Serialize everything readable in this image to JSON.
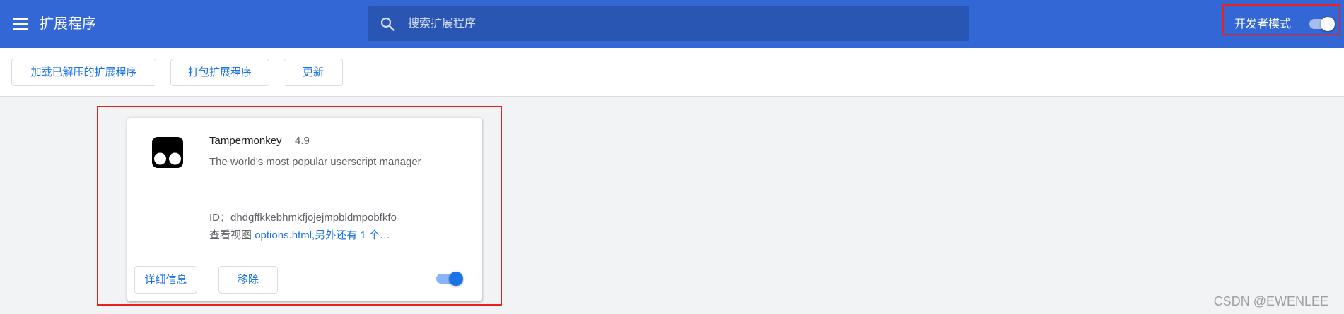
{
  "header": {
    "title": "扩展程序",
    "menu_icon": "hamburger-menu-icon",
    "search": {
      "placeholder": "搜索扩展程序",
      "value": "",
      "icon": "search-icon"
    },
    "dev_mode": {
      "label": "开发者模式",
      "enabled": true
    },
    "background_color": "#3367d6"
  },
  "toolbar": {
    "load_unpacked_label": "加载已解压的扩展程序",
    "pack_label": "打包扩展程序",
    "update_label": "更新"
  },
  "extension": {
    "name": "Tampermonkey",
    "version": "4.9",
    "description": "The world's most popular userscript manager",
    "id_text": "ID：dhdgffkkebhmkfjojejmpbldmpobfkfo",
    "views_label": "查看视图",
    "views_link": "options.html,另外还有 1 个…",
    "details_label": "详细信息",
    "remove_label": "移除",
    "enabled": true,
    "icon": "tampermonkey-icon"
  },
  "watermark": "CSDN @EWENLEE",
  "colors": {
    "accent": "#1a73e8",
    "highlight_border": "#e8201f"
  }
}
